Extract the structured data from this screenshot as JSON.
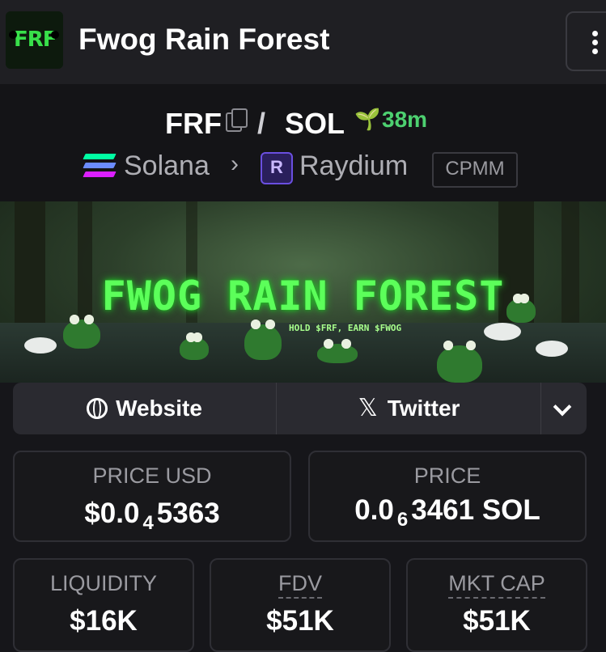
{
  "header": {
    "logo_text": "FRF",
    "title": "Fwog Rain Forest",
    "menu_icon": "kebab-vertical-icon"
  },
  "pair": {
    "base": "FRF",
    "separator": "/",
    "quote": "SOL",
    "age": "38m",
    "chain": "Solana",
    "dex": "Raydium",
    "pool_type": "CPMM"
  },
  "banner": {
    "title": "FWOG RAIN FOREST",
    "subtitle": "HOLD $FRF, EARN $FWOG"
  },
  "links": {
    "website": "Website",
    "twitter": "Twitter"
  },
  "stats": {
    "price_usd": {
      "label": "PRICE USD",
      "prefix": "$0.0",
      "zeros": "4",
      "digits": "5363"
    },
    "price_native": {
      "label": "PRICE",
      "prefix": "0.0",
      "zeros": "6",
      "digits": "3461 SOL"
    },
    "liquidity": {
      "label": "LIQUIDITY",
      "value": "$16K"
    },
    "fdv": {
      "label": "FDV",
      "value": "$51K"
    },
    "mkt_cap": {
      "label": "MKT CAP",
      "value": "$51K"
    }
  },
  "colors": {
    "accent_green": "#4dd070",
    "background": "#16161a",
    "solana_gradient": [
      "#00ffa3",
      "#03e1ff",
      "#dc1fff"
    ]
  }
}
